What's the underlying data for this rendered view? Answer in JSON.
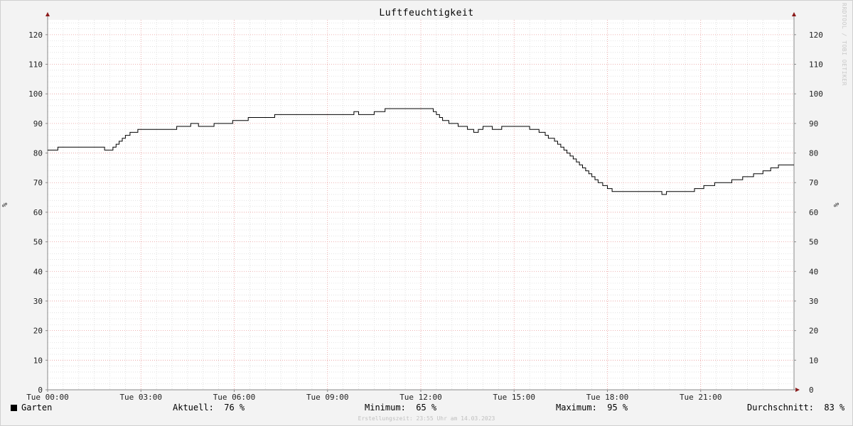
{
  "chart_data": {
    "type": "line",
    "title": "Luftfeuchtigkeit",
    "ylabel": "%",
    "ylim": [
      0,
      125
    ],
    "y_ticks": [
      0,
      10,
      20,
      30,
      40,
      50,
      60,
      70,
      80,
      90,
      100,
      110,
      120
    ],
    "xlim": [
      0,
      24
    ],
    "x_tick_hours": [
      0,
      3,
      6,
      9,
      12,
      15,
      18,
      21
    ],
    "x_tick_labels": [
      "Tue 00:00",
      "Tue 03:00",
      "Tue 06:00",
      "Tue 09:00",
      "Tue 12:00",
      "Tue 15:00",
      "Tue 18:00",
      "Tue 21:00"
    ],
    "grid": true,
    "legend": "bottom-left",
    "series": [
      {
        "name": "Garten",
        "color": "#000000",
        "x": [
          0,
          0.33,
          1.83,
          2.1,
          2.2,
          2.3,
          2.4,
          2.5,
          2.65,
          2.9,
          3.2,
          4.15,
          4.6,
          4.85,
          5.35,
          5.95,
          6.45,
          7.3,
          8.6,
          9.85,
          10.0,
          10.5,
          10.85,
          12.4,
          12.5,
          12.6,
          12.7,
          12.9,
          13.2,
          13.5,
          13.7,
          13.85,
          14.0,
          14.3,
          14.6,
          14.9,
          15.5,
          15.8,
          16.0,
          16.1,
          16.3,
          16.4,
          16.5,
          16.6,
          16.7,
          16.8,
          16.9,
          17.0,
          17.1,
          17.2,
          17.3,
          17.4,
          17.5,
          17.6,
          17.7,
          17.85,
          18.0,
          18.15,
          19.75,
          19.9,
          20.1,
          20.8,
          21.1,
          21.45,
          22.0,
          22.35,
          22.7,
          23.0,
          23.25,
          23.5,
          24.0
        ],
        "y": [
          81,
          82,
          81,
          82,
          83,
          84,
          85,
          86,
          87,
          88,
          88,
          89,
          90,
          89,
          90,
          91,
          92,
          93,
          93,
          94,
          93,
          94,
          95,
          94,
          93,
          92,
          91,
          90,
          89,
          88,
          87,
          88,
          89,
          88,
          89,
          89,
          88,
          87,
          86,
          85,
          84,
          83,
          82,
          81,
          80,
          79,
          78,
          77,
          76,
          75,
          74,
          73,
          72,
          71,
          70,
          69,
          68,
          67,
          66,
          67,
          67,
          68,
          69,
          70,
          71,
          72,
          73,
          74,
          75,
          76,
          76
        ]
      }
    ]
  },
  "legend": {
    "series_name": "Garten",
    "current_label": "Aktuell:",
    "current_value": "76 %",
    "min_label": "Minimum:",
    "min_value": "65 %",
    "max_label": "Maximum:",
    "max_value": "95 %",
    "avg_label": "Durchschnitt:",
    "avg_value": "83 %"
  },
  "watermark": "RRDTOOL / TOBI OETIKER",
  "footer_timestamp": "Erstellungszeit: 23:55 Uhr am 14.03.2023"
}
